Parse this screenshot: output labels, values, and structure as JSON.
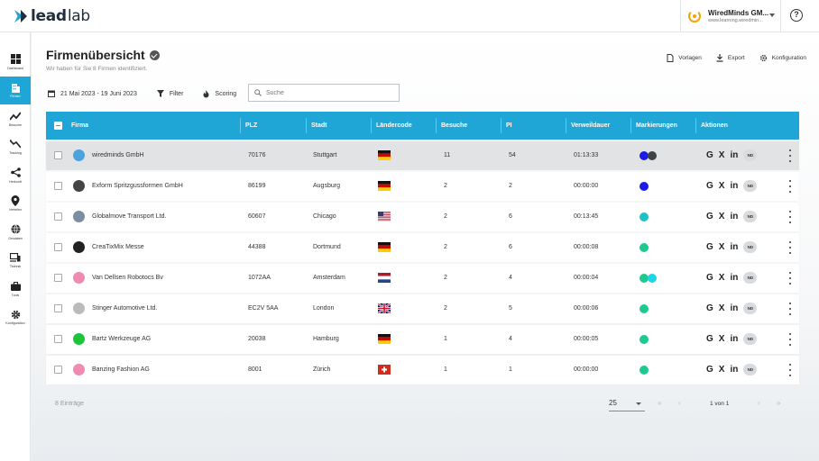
{
  "app": {
    "logo_strong": "lead",
    "logo_light": "lab"
  },
  "account": {
    "name": "WiredMinds GM...",
    "url": "www.learning.wiredmin..."
  },
  "sidebar": {
    "items": [
      {
        "label": "Dashboard",
        "icon": "grid-icon"
      },
      {
        "label": "Firmen",
        "icon": "building-icon",
        "active": true
      },
      {
        "label": "Besuche",
        "icon": "trend-icon"
      },
      {
        "label": "Tracking",
        "icon": "tracking-icon"
      },
      {
        "label": "Herkunft",
        "icon": "share-icon"
      },
      {
        "label": "Verteilen",
        "icon": "pin-icon"
      },
      {
        "label": "Geodaten",
        "icon": "globe-icon"
      },
      {
        "label": "Technik",
        "icon": "devices-icon"
      },
      {
        "label": "Tools",
        "icon": "briefcase-icon"
      },
      {
        "label": "Konfiguration",
        "icon": "gear-icon"
      }
    ]
  },
  "page": {
    "title": "Firmenübersicht",
    "subtitle": "Wir haben für Sie 8 Firmen identifiziert."
  },
  "header_actions": {
    "vorlagen": "Vorlagen",
    "export": "Export",
    "konfiguration": "Konfiguration"
  },
  "filters": {
    "date_range": "21 Mai 2023 - 19 Juni 2023",
    "filter": "Filter",
    "scoring": "Scoring"
  },
  "search": {
    "placeholder": "Suche"
  },
  "table": {
    "columns": [
      "Firma",
      "PLZ",
      "Stadt",
      "Ländercode",
      "Besuche",
      "PI",
      "Verweildauer",
      "Markierungen",
      "Aktionen"
    ],
    "rows": [
      {
        "firma": "wiredminds GmbH",
        "plz": "70176",
        "stadt": "Stuttgart",
        "country": "de",
        "besuche": "11",
        "pi": "54",
        "dauer": "01:13:33",
        "marks": [
          "#1b1be8",
          "#3d4247"
        ],
        "logo": "#4aa3df"
      },
      {
        "firma": "Exform Spritzgussformen GmbH",
        "plz": "86199",
        "stadt": "Augsburg",
        "country": "de",
        "besuche": "2",
        "pi": "2",
        "dauer": "00:00:00",
        "marks": [
          "#1b1be8"
        ],
        "logo": "#444"
      },
      {
        "firma": "Globalmove Transport Ltd.",
        "plz": "60607",
        "stadt": "Chicago",
        "country": "us",
        "besuche": "2",
        "pi": "6",
        "dauer": "00:13:45",
        "marks": [
          "#1fc1c4"
        ],
        "logo": "#7a8fa3"
      },
      {
        "firma": "CreaTixMix Messe",
        "plz": "44388",
        "stadt": "Dortmund",
        "country": "de",
        "besuche": "2",
        "pi": "6",
        "dauer": "00:00:08",
        "marks": [
          "#1ec98f"
        ],
        "logo": "#222"
      },
      {
        "firma": "Van Dellsen Robotocs Bv",
        "plz": "1072AA",
        "stadt": "Amsterdam",
        "country": "nl",
        "besuche": "2",
        "pi": "4",
        "dauer": "00:00:04",
        "marks": [
          "#1ec98f",
          "#1fd4e6"
        ],
        "logo": "#f08ab0"
      },
      {
        "firma": "Stinger Automotive Ltd.",
        "plz": "EC2V 5AA",
        "stadt": "London",
        "country": "gb",
        "besuche": "2",
        "pi": "5",
        "dauer": "00:00:06",
        "marks": [
          "#1ec98f"
        ],
        "logo": "#bbb"
      },
      {
        "firma": "Bartz Werkzeuge AG",
        "plz": "20038",
        "stadt": "Hamburg",
        "country": "de",
        "besuche": "1",
        "pi": "4",
        "dauer": "00:00:05",
        "marks": [
          "#1ec98f"
        ],
        "logo": "#1cc43c"
      },
      {
        "firma": "Banzing Fashion AG",
        "plz": "8001",
        "stadt": "Zürich",
        "country": "ch",
        "besuche": "1",
        "pi": "1",
        "dauer": "00:00:00",
        "marks": [
          "#1ec98f"
        ],
        "logo": "#f08ab0"
      }
    ],
    "action_labels": {
      "google": "G",
      "xing": "X",
      "linkedin": "in",
      "nd": "ND"
    }
  },
  "footer": {
    "count": "8 Einträge",
    "page_size": "25",
    "page_info": "1 von 1",
    "first": "«",
    "prev": "‹",
    "next": "›",
    "last": "»"
  },
  "colors": {
    "accent": "#1fa6d6"
  }
}
